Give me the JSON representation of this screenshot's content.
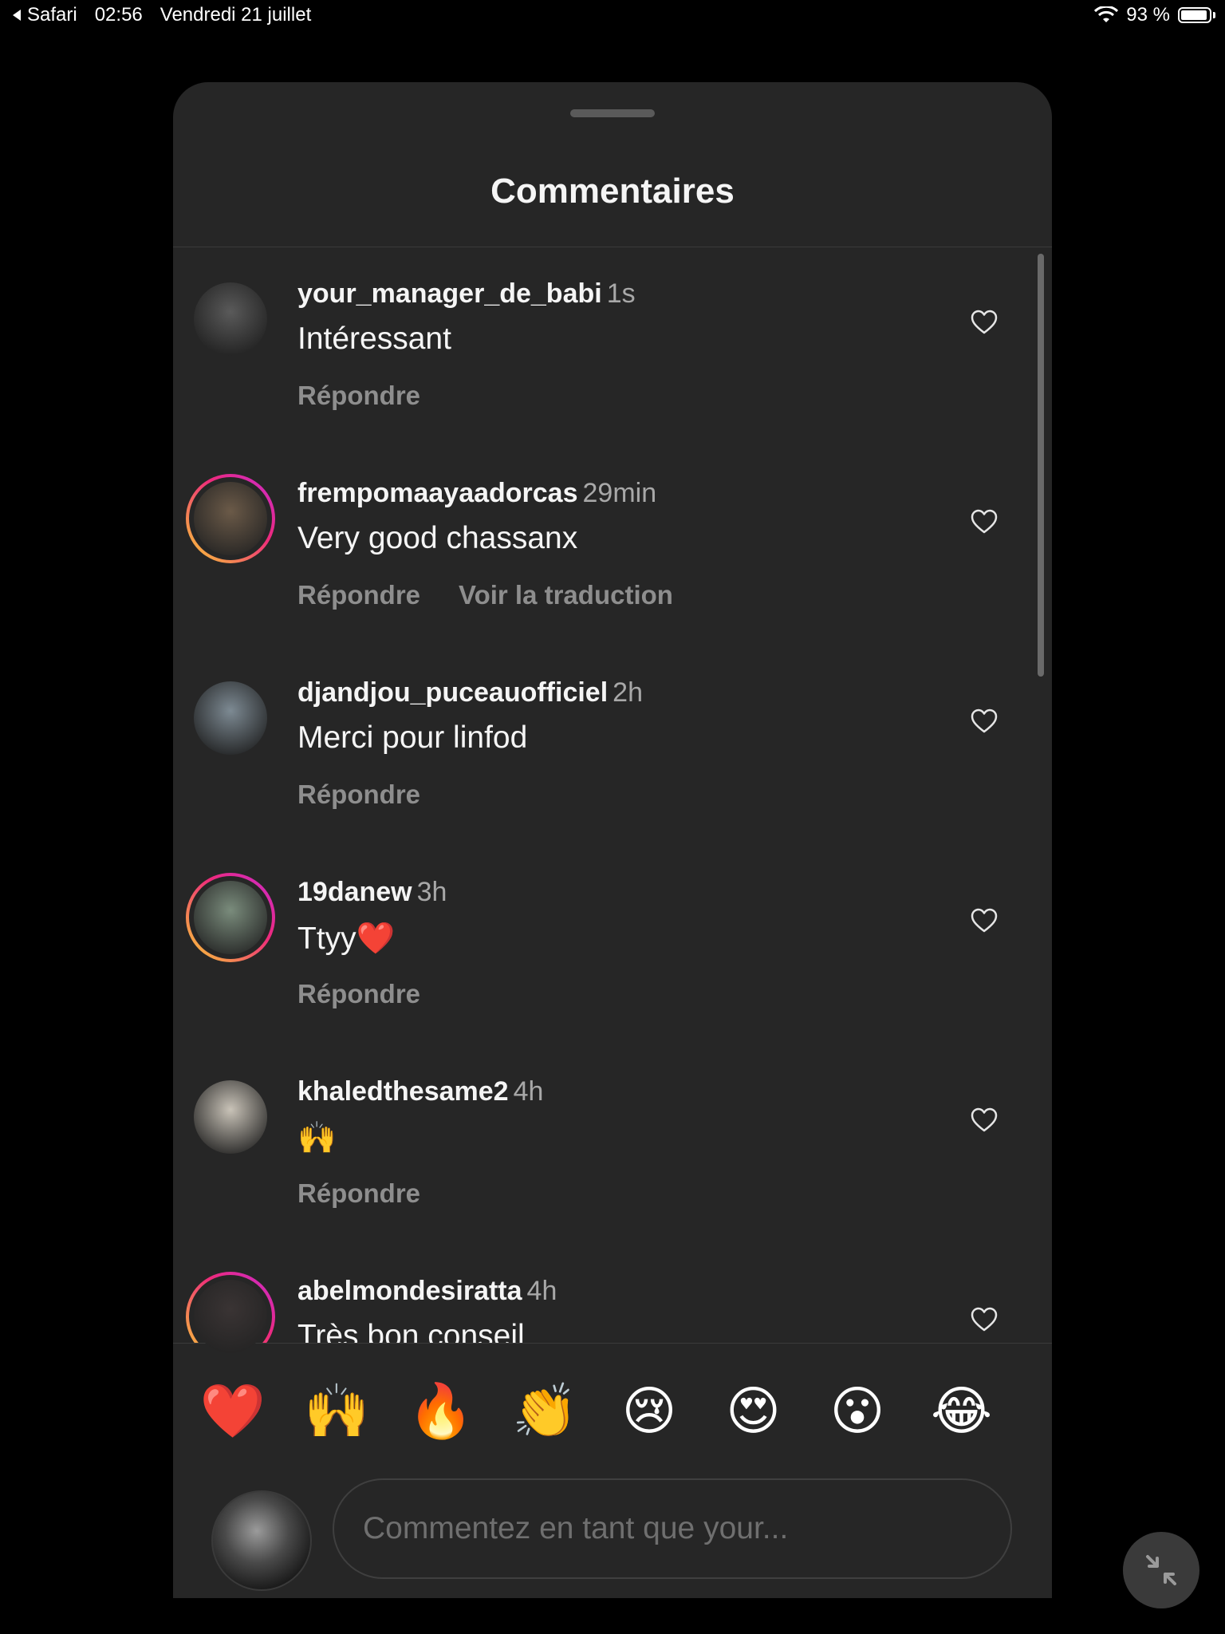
{
  "status_bar": {
    "back_app": "Safari",
    "time": "02:56",
    "date": "Vendredi 21 juillet",
    "battery_label": "93 %",
    "battery_level": 0.93
  },
  "sheet": {
    "title": "Commentaires"
  },
  "comments": [
    {
      "username": "your_manager_de_babi",
      "time": "1s",
      "text": "Intéressant",
      "actions": [
        "Répondre"
      ],
      "story_ring": false,
      "avatar_color": "#5a5a5a"
    },
    {
      "username": "frempomaayaadorcas",
      "time": "29min",
      "text": "Very good chassanx",
      "actions": [
        "Répondre",
        "Voir la traduction"
      ],
      "story_ring": true,
      "avatar_color": "#6b5a48"
    },
    {
      "username": "djandjou_puceauofficiel",
      "time": "2h",
      "text": "Merci pour linfod",
      "actions": [
        "Répondre"
      ],
      "story_ring": false,
      "avatar_color": "#7d8a93"
    },
    {
      "username": "19danew",
      "time": "3h",
      "text": "Ttyy❤️",
      "actions": [
        "Répondre"
      ],
      "story_ring": true,
      "avatar_color": "#7a8c7c"
    },
    {
      "username": "khaledthesame2",
      "time": "4h",
      "text": "🙌",
      "actions": [
        "Répondre"
      ],
      "story_ring": false,
      "avatar_color": "#c9c3b8"
    },
    {
      "username": "abelmondesiratta",
      "time": "4h",
      "text": "Très bon conseil",
      "actions": [],
      "story_ring": true,
      "avatar_color": "#3a3434"
    }
  ],
  "emoji_bar": [
    "❤️",
    "🙌",
    "🔥",
    "👏",
    "😢",
    "😍",
    "😮",
    "😂"
  ],
  "composer": {
    "placeholder": "Commentez en tant que your..."
  },
  "icons": {
    "like": "heart-outline-icon",
    "float": "minimize-arrows-icon"
  }
}
